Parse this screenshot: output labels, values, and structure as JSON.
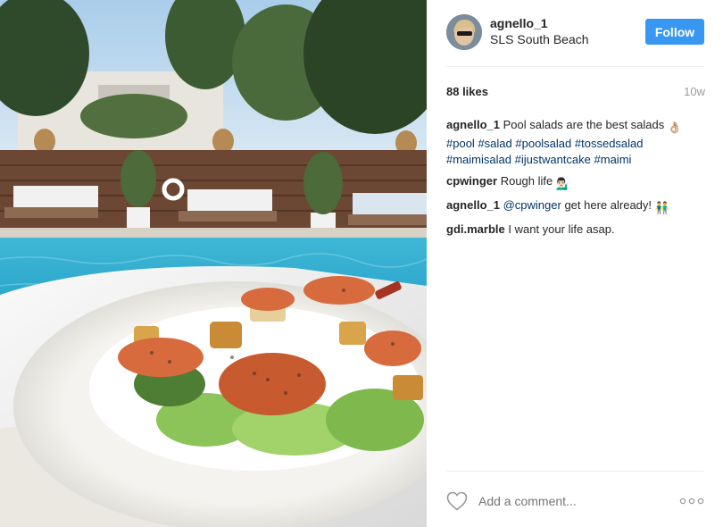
{
  "post": {
    "username": "agnello_1",
    "location": "SLS South Beach",
    "follow_label": "Follow",
    "likes": "88 likes",
    "age": "10w"
  },
  "comments": [
    {
      "user": "agnello_1",
      "text": "Pool salads are the best salads",
      "emoji": "👌🏼",
      "tags": [
        "#pool",
        "#salad",
        "#poolsalad",
        "#tossedsalad",
        "#maimisalad",
        "#ijustwantcake",
        "#maimi"
      ]
    },
    {
      "user": "cpwinger",
      "text": "Rough life",
      "emoji": "💁🏻‍♂"
    },
    {
      "user": "agnello_1",
      "mention": "@cpwinger",
      "text": "get here already!",
      "emoji": "👬"
    },
    {
      "user": "gdi.marble",
      "text": "I want your life asap."
    }
  ],
  "add_comment": {
    "placeholder": "Add a comment..."
  },
  "icons": {
    "like": "heart-icon",
    "options": "more-options-icon"
  },
  "colors": {
    "follow_button": "#3897f0",
    "hashtag": "#003569",
    "muted": "#999999"
  }
}
